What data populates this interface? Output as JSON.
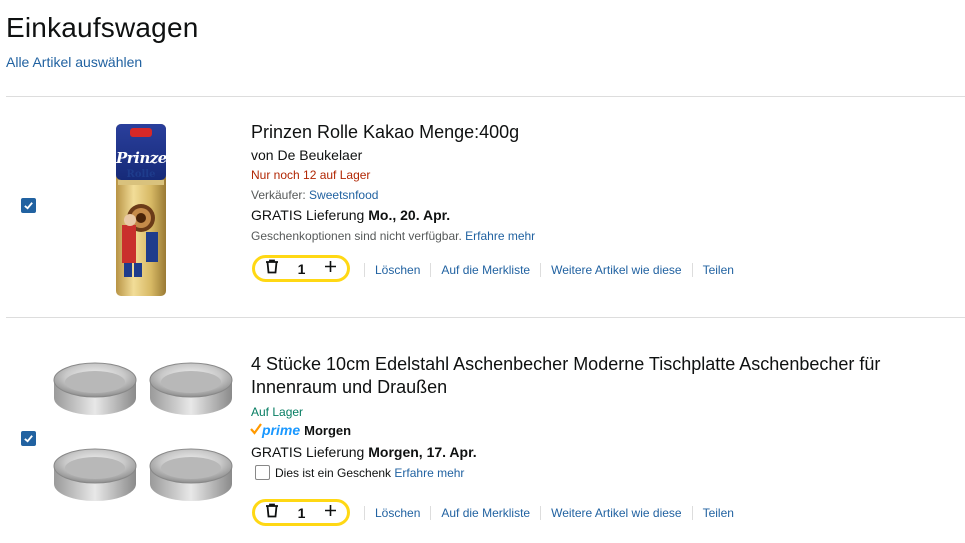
{
  "page": {
    "title": "Einkaufswagen",
    "select_all": "Alle Artikel auswählen"
  },
  "items": [
    {
      "title": "Prinzen Rolle Kakao Menge:400g",
      "brand": "von De Beukelaer",
      "stock": "Nur noch 12 auf Lager",
      "seller_label": "Verkäufer:",
      "seller": "Sweetsnfood",
      "delivery_prefix": "GRATIS Lieferung",
      "delivery_date": "Mo., 20. Apr.",
      "gift_text": "Geschenkoptionen sind nicht verfügbar.",
      "learn_more": "Erfahre mehr",
      "quantity": "1",
      "checked": true,
      "image_icon": "prinzen-rolle-package-image",
      "product_label_top": "Prinzen",
      "product_label_bottom": "Rolle",
      "actions": [
        "Löschen",
        "Auf die Merkliste",
        "Weitere Artikel wie diese",
        "Teilen"
      ]
    },
    {
      "title_line1": "4 Stücke 10cm Edelstahl Aschenbecher Moderne Tischplatte Aschenbecher für",
      "title_line2": "Innenraum und Draußen",
      "stock": "Auf Lager",
      "prime_logo": "prime",
      "prime_delivery": "Morgen",
      "delivery_prefix": "GRATIS Lieferung",
      "delivery_date": "Morgen, 17. Apr.",
      "gift_text": "Dies ist ein Geschenk",
      "learn_more": "Erfahre mehr",
      "quantity": "1",
      "checked": true,
      "image_icon": "ashtrays-image",
      "actions": [
        "Löschen",
        "Auf die Merkliste",
        "Weitere Artikel wie diese",
        "Teilen"
      ]
    }
  ],
  "colors": {
    "link": "#2162a1",
    "low_stock": "#b12704",
    "in_stock": "#067d62",
    "quantity_border": "#ffd814",
    "checkbox": "#2162a1",
    "prime_check": "#ff9900",
    "prime_text": "#1a98ff"
  },
  "icons": {
    "trash": "trash-icon",
    "plus": "plus-icon",
    "check": "checkmark-icon"
  }
}
